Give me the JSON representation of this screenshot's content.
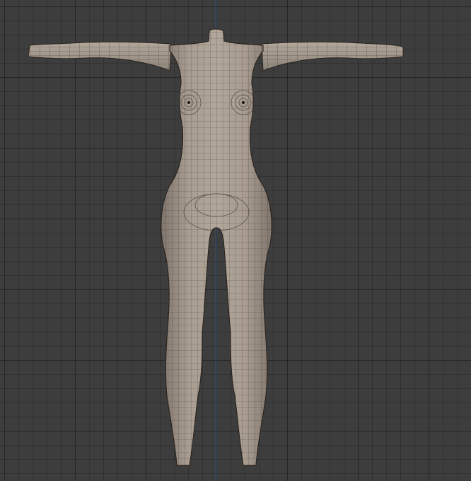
{
  "viewport": {
    "background_color": "#3d3d3d",
    "grid_color": "#2f2f2f",
    "axis_color": "#3e6fae"
  },
  "model": {
    "object": "mesh-body",
    "shading": "solid",
    "wireframe": true,
    "surface_color": "#a2968b",
    "wire_color": "#2b2520"
  }
}
